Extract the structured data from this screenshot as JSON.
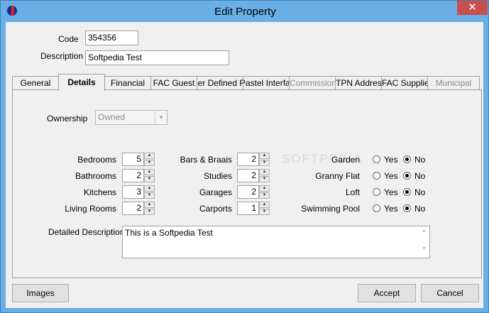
{
  "window": {
    "title": "Edit Property",
    "close_glyph": "✕"
  },
  "form": {
    "code_label": "Code",
    "code_value": "354356",
    "description_label": "Description",
    "description_value": "Softpedia Test"
  },
  "tabs": [
    {
      "label": "General"
    },
    {
      "label": "Details",
      "active": true
    },
    {
      "label": "Financial"
    },
    {
      "label": "FAC Guest"
    },
    {
      "label": "User Defined Fields"
    },
    {
      "label": "Pastel Interface"
    },
    {
      "label": "Commission",
      "disabled": true
    },
    {
      "label": "TPN Address"
    },
    {
      "label": "FAC Supplier"
    },
    {
      "label": "Municipal",
      "disabled": true
    }
  ],
  "details": {
    "ownership_label": "Ownership",
    "ownership_value": "Owned",
    "spinners_left": [
      {
        "label": "Bedrooms",
        "value": "5"
      },
      {
        "label": "Bathrooms",
        "value": "2"
      },
      {
        "label": "Kitchens",
        "value": "3"
      },
      {
        "label": "Living Rooms",
        "value": "2"
      }
    ],
    "spinners_mid": [
      {
        "label": "Bars & Braais",
        "value": "2"
      },
      {
        "label": "Studies",
        "value": "2"
      },
      {
        "label": "Garages",
        "value": "2"
      },
      {
        "label": "Carports",
        "value": "1"
      }
    ],
    "radios": [
      {
        "label": "Garden",
        "yes": "Yes",
        "no": "No",
        "selected": "No"
      },
      {
        "label": "Granny Flat",
        "yes": "Yes",
        "no": "No",
        "selected": "No"
      },
      {
        "label": "Loft",
        "yes": "Yes",
        "no": "No",
        "selected": "No"
      },
      {
        "label": "Swimming Pool",
        "yes": "Yes",
        "no": "No",
        "selected": "No"
      }
    ],
    "detailed_description_label": "Detailed Description",
    "detailed_description_value": "This is a Softpedia Test",
    "watermark": "SOFTPEDIA"
  },
  "buttons": {
    "images": "Images",
    "accept": "Accept",
    "cancel": "Cancel"
  }
}
